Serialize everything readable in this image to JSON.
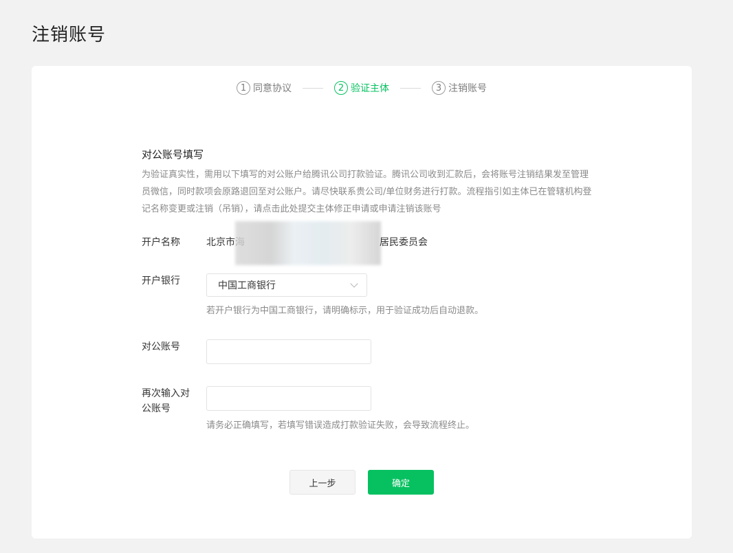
{
  "page": {
    "title": "注销账号"
  },
  "steps": [
    {
      "num": "1",
      "label": "同意协议"
    },
    {
      "num": "2",
      "label": "验证主体"
    },
    {
      "num": "3",
      "label": "注销账号"
    }
  ],
  "active_step": 2,
  "section": {
    "title": "对公账号填写",
    "description": "为验证真实性，需用以下填写的对公账户给腾讯公司打款验证。腾讯公司收到汇款后，会将账号注销结果发至管理员微信，同时款项会原路退回至对公账户。请尽快联系贵公司/单位财务进行打款。流程指引如主体已在管辖机构登记名称变更或注销（吊销），请点击此处提交主体修正申请或申请注销该账号"
  },
  "form": {
    "account_name": {
      "label": "开户名称",
      "value_prefix": "北京市海",
      "value_suffix": "居民委员会"
    },
    "bank": {
      "label": "开户银行",
      "selected": "中国工商银行",
      "hint": "若开户银行为中国工商银行，请明确标示，用于验证成功后自动退款。"
    },
    "account_no": {
      "label": "对公账号",
      "value": "",
      "placeholder": ""
    },
    "account_no_confirm": {
      "label_line1": "再次输入对",
      "label_line2": "公账号",
      "value": "",
      "placeholder": "",
      "hint": "请务必正确填写，若填写错误造成打款验证失败，会导致流程终止。"
    }
  },
  "buttons": {
    "prev": "上一步",
    "confirm": "确定"
  },
  "colors": {
    "accent": "#07c160",
    "background": "#f2f2f2",
    "card": "#ffffff"
  }
}
